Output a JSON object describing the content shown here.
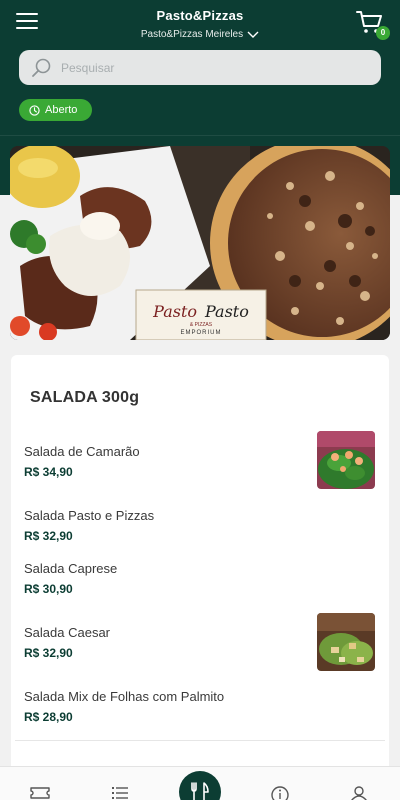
{
  "header": {
    "title": "Pasto&Pizzas",
    "store": "Pasto&Pizzas Meireles",
    "cart_count": "0",
    "bg_color": "#0c3d33"
  },
  "search": {
    "placeholder": "Pesquisar"
  },
  "status": {
    "label": "Aberto",
    "color": "#3aa935"
  },
  "banner": {
    "logo_left": "Pasto",
    "logo_right": "Pasto",
    "logo_sub": "& PIZZAS",
    "logo_bottom": "EMPORIUM"
  },
  "menu": {
    "section_title": "SALADA 300g",
    "items": [
      {
        "name": "Salada de Camarão",
        "price": "R$ 34,90",
        "has_image": true
      },
      {
        "name": "Salada Pasto e Pizzas",
        "price": "R$ 32,90",
        "has_image": false
      },
      {
        "name": "Salada Caprese",
        "price": "R$ 30,90",
        "has_image": false
      },
      {
        "name": "Salada Caesar",
        "price": "R$ 32,90",
        "has_image": true
      },
      {
        "name": "Salada Mix de Folhas com Palmito",
        "price": "R$ 28,90",
        "has_image": false
      }
    ]
  },
  "bottom_nav": {
    "items": [
      "ticket-icon",
      "list-icon",
      "fork-knife-icon",
      "info-icon",
      "user-icon"
    ],
    "active": "fork-knife-icon"
  }
}
